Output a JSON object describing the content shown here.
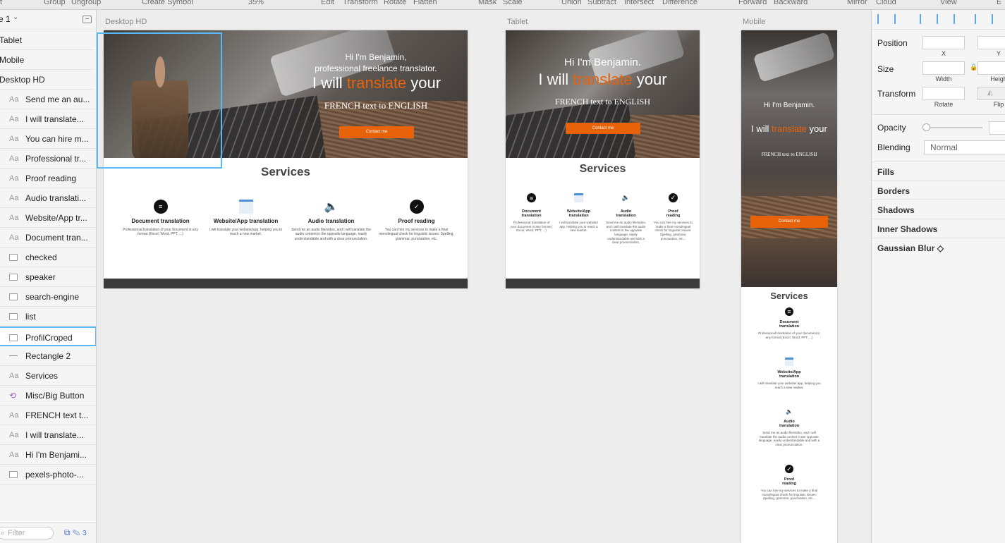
{
  "toolbar": {
    "items": [
      "t",
      "Group",
      "Ungroup",
      "Create Symbol",
      "35%",
      "Edit",
      "Transform",
      "Rotate",
      "Flatten",
      "Mask",
      "Scale",
      "Union",
      "Subtract",
      "Intersect",
      "Difference",
      "Forward",
      "Backward",
      "Mirror",
      "Cloud",
      "View",
      "E"
    ]
  },
  "layers": {
    "page": "e 1",
    "artboards": [
      "Tablet",
      "Mobile",
      "Desktop HD"
    ],
    "items": [
      {
        "label": "Send me an au...",
        "kind": "text"
      },
      {
        "label": "I will translate...",
        "kind": "text"
      },
      {
        "label": "You can hire m...",
        "kind": "text"
      },
      {
        "label": "Professional tr...",
        "kind": "text"
      },
      {
        "label": "Proof reading",
        "kind": "text"
      },
      {
        "label": "Audio translati...",
        "kind": "text"
      },
      {
        "label": "Website/App tr...",
        "kind": "text"
      },
      {
        "label": "Document tran...",
        "kind": "text"
      },
      {
        "label": "checked",
        "kind": "image"
      },
      {
        "label": "speaker",
        "kind": "image"
      },
      {
        "label": "search-engine",
        "kind": "image"
      },
      {
        "label": "list",
        "kind": "image"
      },
      {
        "label": "ProfilCroped",
        "kind": "image",
        "selected": true
      },
      {
        "label": "Rectangle 2",
        "kind": "shape"
      },
      {
        "label": "Services",
        "kind": "text"
      },
      {
        "label": "Misc/Big Button",
        "kind": "symbol"
      },
      {
        "label": "FRENCH text t...",
        "kind": "text"
      },
      {
        "label": "I will translate...",
        "kind": "text"
      },
      {
        "label": "Hi I'm Benjami...",
        "kind": "text"
      },
      {
        "label": "pexels-photo-...",
        "kind": "image"
      }
    ],
    "text_icon": "Aa",
    "filter_placeholder": "Filter",
    "filter_count": "3"
  },
  "artboards": {
    "desktop": {
      "label": "Desktop HD",
      "hero_line1": "Hi I'm Benjamin,",
      "hero_line2": "professional freelance translator.",
      "hero_big_a": "I will ",
      "hero_big_b": "translate",
      "hero_big_c": " your",
      "hero_sub": "FRENCH text to ENGLISH",
      "button": "Contact me",
      "services_title": "Services",
      "services": [
        {
          "icon": "≡",
          "title": "Document translation",
          "desc": "Professional translation of your document in any format (Excel, Word, PPT, ...)"
        },
        {
          "icon": "",
          "title": "Website/App translation",
          "desc": "I will translate your website/app, helping you to reach a new market."
        },
        {
          "icon": "🔈",
          "title": "Audio translation",
          "desc": "Send me an audio file/video, and I will translate the audio content in the opposite language, easily understandable and with a clear pronunciation."
        },
        {
          "icon": "✓",
          "title": "Proof reading",
          "desc": "You can hire my services to make a final monolingual check for linguistic issues: Spelling, grammar, punctuation, etc."
        }
      ]
    },
    "tablet": {
      "label": "Tablet",
      "hero_line1": "Hi I'm Benjamin.",
      "hero_big_a": "I will ",
      "hero_big_b": "translate",
      "hero_big_c": " your",
      "hero_sub": "FRENCH text to ENGLISH",
      "button": "Contact me",
      "services_title": "Services",
      "services": [
        {
          "icon": "≡",
          "title_1": "Document",
          "title_2": "translation",
          "desc": "Professional translation of your document in any format ( Excel, Word, PPT, ...)"
        },
        {
          "icon": "",
          "title_1": "Website/App",
          "title_2": "translation",
          "desc": "I will translate your website/ app, helping you to reach a new market."
        },
        {
          "icon": "🔈",
          "title_1": "Audio",
          "title_2": "translation",
          "desc": "Send me an audio file/video, and I will translate the audio content in the opposite language, easily understandable and with a clear pronunciation."
        },
        {
          "icon": "✓",
          "title_1": "Proof",
          "title_2": "reading",
          "desc": "You can hire my services to make a final monolingual check for linguistic issues: Spelling, grammar, punctuation, etc..."
        }
      ]
    },
    "mobile": {
      "label": "Mobile",
      "hero_line1": "Hi I'm Benjamin.",
      "hero_big_a": "I will ",
      "hero_big_b": "translate",
      "hero_big_c": " your",
      "hero_sub": "FRENCH text to ENGLISH",
      "button": "Contact me",
      "services_title": "Services",
      "services": [
        {
          "icon": "≡",
          "title_1": "Document",
          "title_2": "translation",
          "desc": "Professional translation of your document in any format (Excel, Word, PPT, ...)"
        },
        {
          "icon": "",
          "title_1": "Website/App",
          "title_2": "translation",
          "desc": "I will translate your website/ app, helping you reach a new market."
        },
        {
          "icon": "🔈",
          "title_1": "Audio",
          "title_2": "translation",
          "desc": "Send me an audio file/video, and I will translate the audio content in the opposite language, easily understandable and with a clear pronunciation."
        },
        {
          "icon": "✓",
          "title_1": "Proof",
          "title_2": "reading",
          "desc": "You can hire my services to make a final monolingual check for linguistic issues: Spelling, grammar, punctuation, etc..."
        }
      ]
    }
  },
  "inspector": {
    "position": "Position",
    "size": "Size",
    "transform": "Transform",
    "x": "X",
    "y": "Y",
    "width": "Width",
    "height": "Heigh",
    "rotate": "Rotate",
    "flip": "Flip",
    "opacity": "Opacity",
    "blending": "Blending",
    "blend_value": "Normal",
    "sections": [
      "Fills",
      "Borders",
      "Shadows",
      "Inner Shadows",
      "Gaussian Blur ◇"
    ]
  },
  "colors": {
    "accent": "#e8620a",
    "selection": "#59b9f4",
    "footer": "#3a3a3a"
  }
}
